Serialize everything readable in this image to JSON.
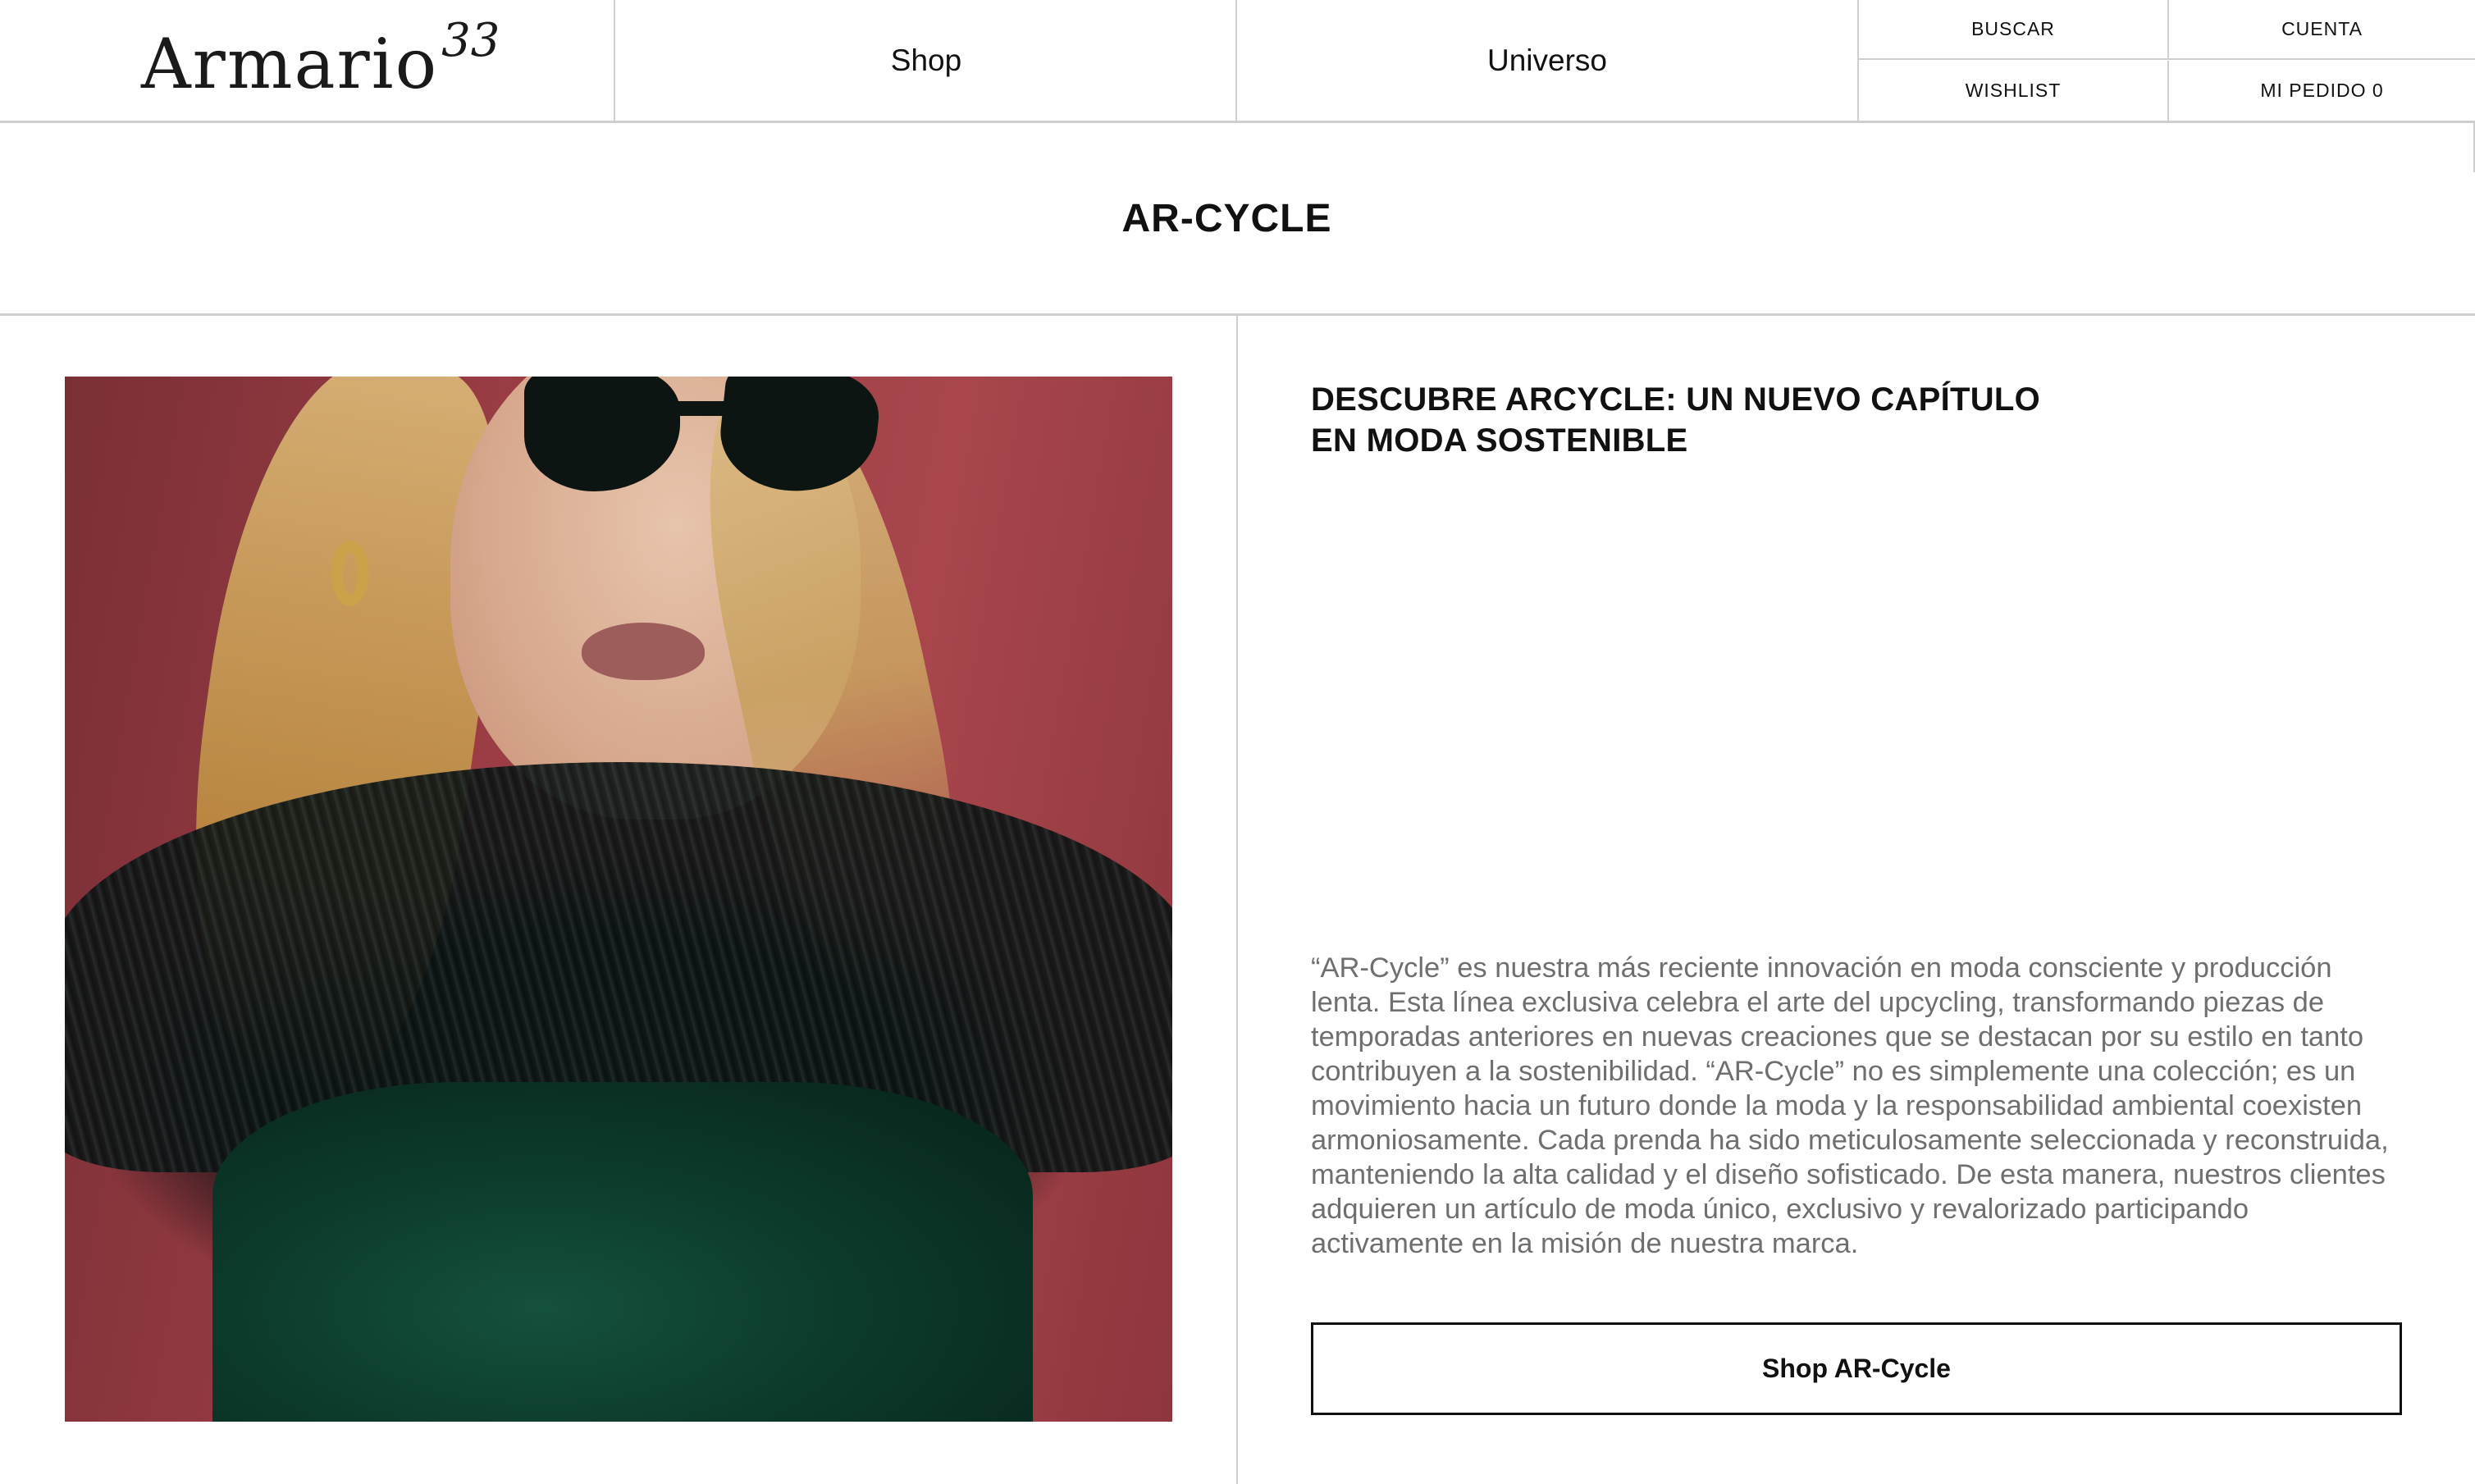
{
  "brand": {
    "name": "Armario",
    "superscript": "33"
  },
  "nav": {
    "shop": "Shop",
    "universo": "Universo"
  },
  "utility": {
    "search": "BUSCAR",
    "account": "CUENTA",
    "wishlist": "WISHLIST",
    "order": "MI PEDIDO 0"
  },
  "page": {
    "title": "AR-CYCLE"
  },
  "content": {
    "heading_line1": "DESCUBRE ARCYCLE: UN NUEVO CAPÍTULO",
    "heading_line2": "EN MODA SOSTENIBLE",
    "body": "“AR-Cycle” es nuestra más reciente innovación en moda consciente y producción lenta. Esta línea exclusiva celebra el arte del upcycling, transformando piezas de temporadas anteriores en nuevas creaciones que se destacan por su estilo en tanto contribuyen a la sostenibilidad. “AR-Cycle” no es simplemente una colección; es un movimiento hacia un futuro donde la moda y la responsabilidad ambiental coexisten armoniosamente. Cada prenda ha sido meticulosamente seleccionada y reconstruida, manteniendo la alta calidad y el diseño sofisticado. De esta manera, nuestros clientes adquieren un artículo de moda único, exclusivo y revalorizado participando activamente en la misión de nuestra marca.",
    "cta": "Shop AR-Cycle"
  },
  "colors": {
    "border": "#cfcfcf",
    "text": "#111111",
    "body_text": "#6f6f6f",
    "background": "#ffffff"
  }
}
